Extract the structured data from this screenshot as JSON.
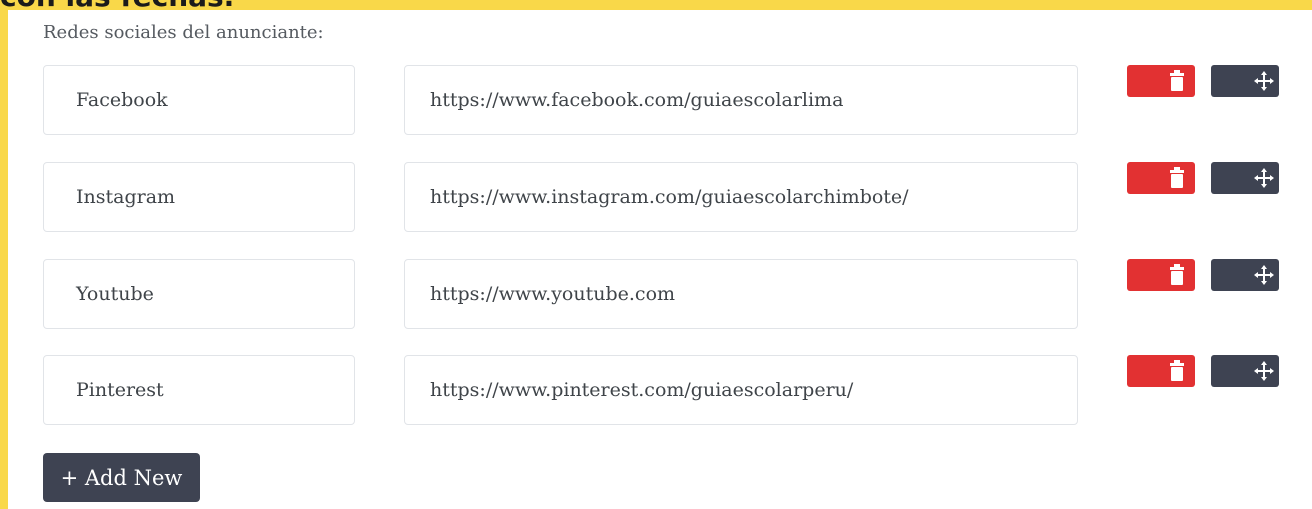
{
  "page": {
    "top_text": "con las fechas."
  },
  "section": {
    "label": "Redes sociales del anunciante:"
  },
  "rows": [
    {
      "name": "Facebook",
      "url": "https://www.facebook.com/guiaescolarlima"
    },
    {
      "name": "Instagram",
      "url": "https://www.instagram.com/guiaescolarchimbote/"
    },
    {
      "name": "Youtube",
      "url": "https://www.youtube.com"
    },
    {
      "name": "Pinterest",
      "url": "https://www.pinterest.com/guiaescolarperu/"
    }
  ],
  "actions": {
    "delete_icon": "trash-icon",
    "move_icon": "move-arrows-icon",
    "add_label": "+ Add New"
  },
  "colors": {
    "delete": "#e23132",
    "move": "#3e4352",
    "page_background": "#f9d849"
  }
}
